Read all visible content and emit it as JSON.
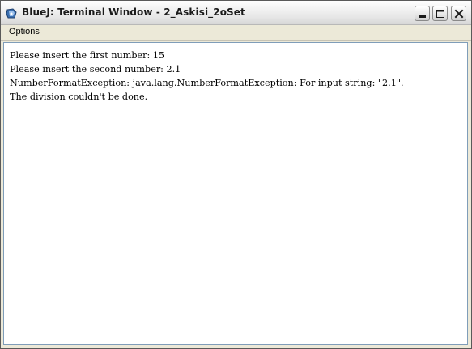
{
  "window": {
    "title": "BlueJ: Terminal Window - 2_Askisi_2oSet",
    "icon": "bluej-app-icon",
    "controls": {
      "minimize": "minimize-icon",
      "maximize": "maximize-icon",
      "close": "close-icon"
    }
  },
  "menubar": {
    "items": [
      {
        "label": "Options"
      }
    ]
  },
  "terminal": {
    "lines": [
      "Please insert the first number: 15",
      "Please insert the second number: 2.1",
      "NumberFormatException: java.lang.NumberFormatException: For input string: \"2.1\".",
      "The division couldn't be done."
    ]
  },
  "colors": {
    "window_bg": "#ece9d8",
    "terminal_bg": "#ffffff",
    "text": "#000000",
    "close_glyph": "#000000"
  }
}
